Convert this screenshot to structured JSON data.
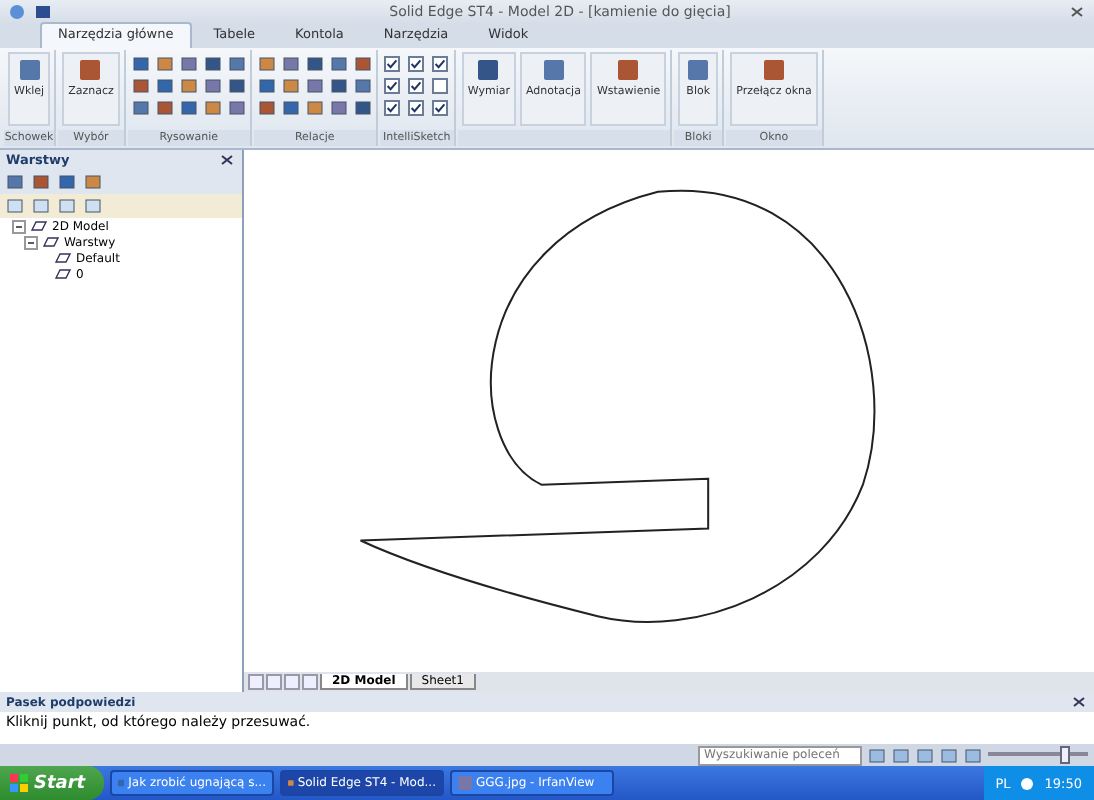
{
  "window": {
    "title": "Solid Edge ST4 - Model 2D - [kamienie do gięcia]"
  },
  "ribbon_tabs": [
    {
      "label": "Narzędzia główne",
      "selected": true
    },
    {
      "label": "Tabele",
      "selected": false
    },
    {
      "label": "Kontola",
      "selected": false
    },
    {
      "label": "Narzędzia",
      "selected": false
    },
    {
      "label": "Widok",
      "selected": false
    }
  ],
  "ribbon_groups": [
    {
      "kind": "large",
      "label": "Schowek",
      "buttons": [
        "Wklej"
      ]
    },
    {
      "kind": "large",
      "label": "Wybór",
      "buttons": [
        "Zaznacz"
      ]
    },
    {
      "kind": "tools",
      "label": "Rysowanie"
    },
    {
      "kind": "tools",
      "label": "Relacje"
    },
    {
      "kind": "checks",
      "label": "IntelliSketch",
      "checks": [
        {
          "checked": true
        },
        {
          "checked": true
        },
        {
          "checked": true
        },
        {
          "checked": true
        },
        {
          "checked": true
        },
        {
          "checked": false
        },
        {
          "checked": true
        },
        {
          "checked": true
        },
        {
          "checked": true
        }
      ]
    },
    {
      "kind": "large",
      "buttons": [
        "Wymiar",
        "Adnotacja",
        "Wstawienie"
      ]
    },
    {
      "kind": "large",
      "label": "Bloki",
      "buttons": [
        "Blok"
      ]
    },
    {
      "kind": "large",
      "label": "Okno",
      "buttons": [
        "Przełącz okna"
      ]
    }
  ],
  "panel": {
    "title": "Warstwy",
    "tree": [
      {
        "label": "2D Model",
        "expanded": true,
        "children": [
          {
            "label": "Warstwy",
            "expanded": true,
            "children": [
              {
                "label": "Default"
              },
              {
                "label": "0"
              }
            ]
          }
        ]
      }
    ]
  },
  "sheet_tabs": [
    {
      "label": "2D Model",
      "selected": true
    },
    {
      "label": "Sheet1",
      "selected": false
    }
  ],
  "hint_bar": {
    "title": "Pasek podpowiedzi",
    "text": "Kliknij punkt, od którego należy przesuwać."
  },
  "status_bar": {
    "search": {
      "placeholder": "Wyszukiwanie poleceń"
    },
    "zoom": {
      "level": 0.72
    }
  },
  "taskbar": {
    "start": "Start",
    "tasks": [
      {
        "label": "Jak zrobić ugnającą s...",
        "selected": false
      },
      {
        "label": "Solid Edge ST4 - Mod...",
        "selected": true
      },
      {
        "label": "GGG.jpg - IrfanView",
        "selected": false
      }
    ],
    "language": "PL",
    "clock": "19:50"
  }
}
